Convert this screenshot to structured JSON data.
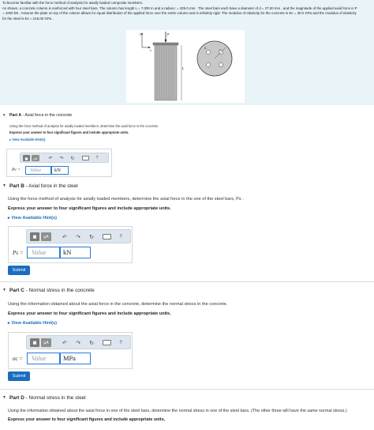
{
  "intro": {
    "line1": "To become familiar with the force method of analysis for axially loaded composite members.",
    "line2": "As shown, a concrete column is reinforced with four steel bars. The column has length L = 7.000 m and a radius r = 325.0 mm . The steel bars each have a diameter of d = 27.00 mm , and the magnitude of the applied axial force is P",
    "line3": "= 1000 kN . Assume the plate on top of the column allows for equal distribution of the applied force over the entire column and is infinitely rigid. The modulus of elasticity for the concrete is Ec = 30.0 GPa and the modulus of elasticity",
    "line4": "for the steel is Es = 215.00 GPa .",
    "fig_P": "P",
    "fig_y": "y",
    "fig_x": "x",
    "fig_L": "L",
    "fig_r": "r",
    "fig_d": "d"
  },
  "toolbar": {
    "mat_icon": "matrix-icon",
    "mu_label": "μA",
    "undo": "↶",
    "redo": "↷",
    "reset": "↻",
    "kb_label": "⌨",
    "help": "?"
  },
  "partA": {
    "head": "Part A",
    "title": " - Axial force in the concrete",
    "prompt": "Using the force method of analysis for axially loaded members, determine the axial force in the concrete.",
    "instr": "Express your answer to four significant figures and include appropriate units.",
    "hint": "View Available Hint(s)",
    "var": "Pc =",
    "value_placeholder": "Value",
    "unit": "kN"
  },
  "partB": {
    "head": "Part B",
    "title": " - Axial force in the steel",
    "prompt": "Using the force method of analysis for axially loaded members, determine the axial force in the one of the steel bars, Ps .",
    "instr": "Express your answer to four significant figures and include appropriate units.",
    "hint": "View Available Hint(s)",
    "var": "Ps =",
    "value_placeholder": "Value",
    "unit": "kN",
    "submit": "Submit"
  },
  "partC": {
    "head": "Part C",
    "title": " - Normal stress in the concrete",
    "prompt": "Using the information obtained about the axial force in the concrete, determine the normal stress in the concrete.",
    "instr": "Express your answer to four significant figures and include appropriate units.",
    "hint": "View Available Hint(s)",
    "var": "σc =",
    "value_placeholder": "Value",
    "unit": "MPa",
    "submit": "Submit"
  },
  "partD": {
    "head": "Part D",
    "title": " - Normal stress in the steel",
    "prompt": "Using the information obtained about the axial force in one of the steel bars, determine the normal stress in one of the steel bars. (The other three will have the same normal stress.)",
    "instr": "Express your answer to four significant figures and include appropriate units."
  }
}
